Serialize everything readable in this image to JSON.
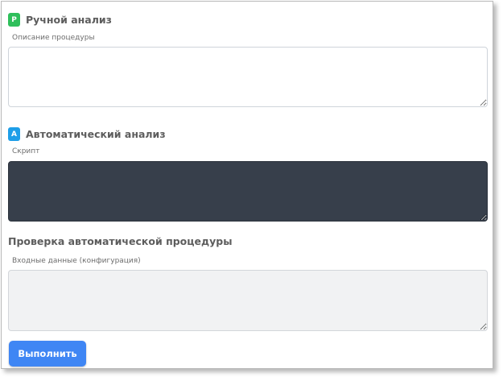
{
  "manual_section": {
    "badge": "P",
    "badge_color": "#2fbf5b",
    "title": "Ручной анализ",
    "field_label": "Описание процедуры",
    "field_value": "",
    "field_placeholder": ""
  },
  "auto_section": {
    "badge": "A",
    "badge_color": "#1e9ee8",
    "title": "Автоматический анализ",
    "field_label": "Скрипт",
    "field_value": "",
    "field_placeholder": ""
  },
  "check_section": {
    "title": "Проверка автоматической процедуры",
    "field_label": "Входные данные (конфигурация)",
    "field_value": "",
    "field_placeholder": ""
  },
  "run_button": {
    "label": "Выполнить",
    "color": "#3f86f4"
  }
}
